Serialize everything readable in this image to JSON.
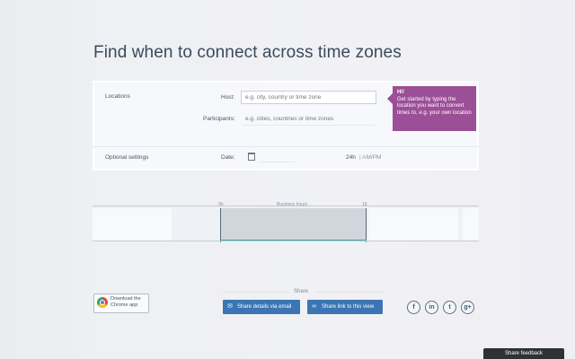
{
  "page": {
    "title": "Find when to connect across time zones"
  },
  "form": {
    "locations_label": "Locations",
    "host_label": "Host:",
    "host_placeholder": "e.g. city, country or time zone",
    "participants_label": "Participants:",
    "participants_placeholder": "e.g. cities, countries or time zones",
    "optional_label": "Optional settings",
    "date_label": "Date:",
    "format_24h": "24h",
    "format_ampm": "| AM/PM"
  },
  "tooltip": {
    "title": "Hi!",
    "text": "Get started by typing the location you want to convert times to, e.g. your own location",
    "color": "#9b4f96"
  },
  "timeline": {
    "left_tick": "9h",
    "middle_label": "Business hours",
    "right_tick": "18",
    "highlight_color": "#d1d6dd",
    "accent_color": "#3aa5a0"
  },
  "chrome_app": {
    "line1": "Download the",
    "line2": "Chrome app"
  },
  "share": {
    "label": "Share",
    "email_button": "Share details via email",
    "link_button": "Share link to this view",
    "button_color": "#3b75b3",
    "social": [
      {
        "icon": "facebook-icon",
        "glyph": "f"
      },
      {
        "icon": "linkedin-icon",
        "glyph": "in"
      },
      {
        "icon": "twitter-icon",
        "glyph": "t"
      },
      {
        "icon": "google-plus-icon",
        "glyph": "g+"
      }
    ]
  },
  "feedback": {
    "label": "Share feedback"
  }
}
